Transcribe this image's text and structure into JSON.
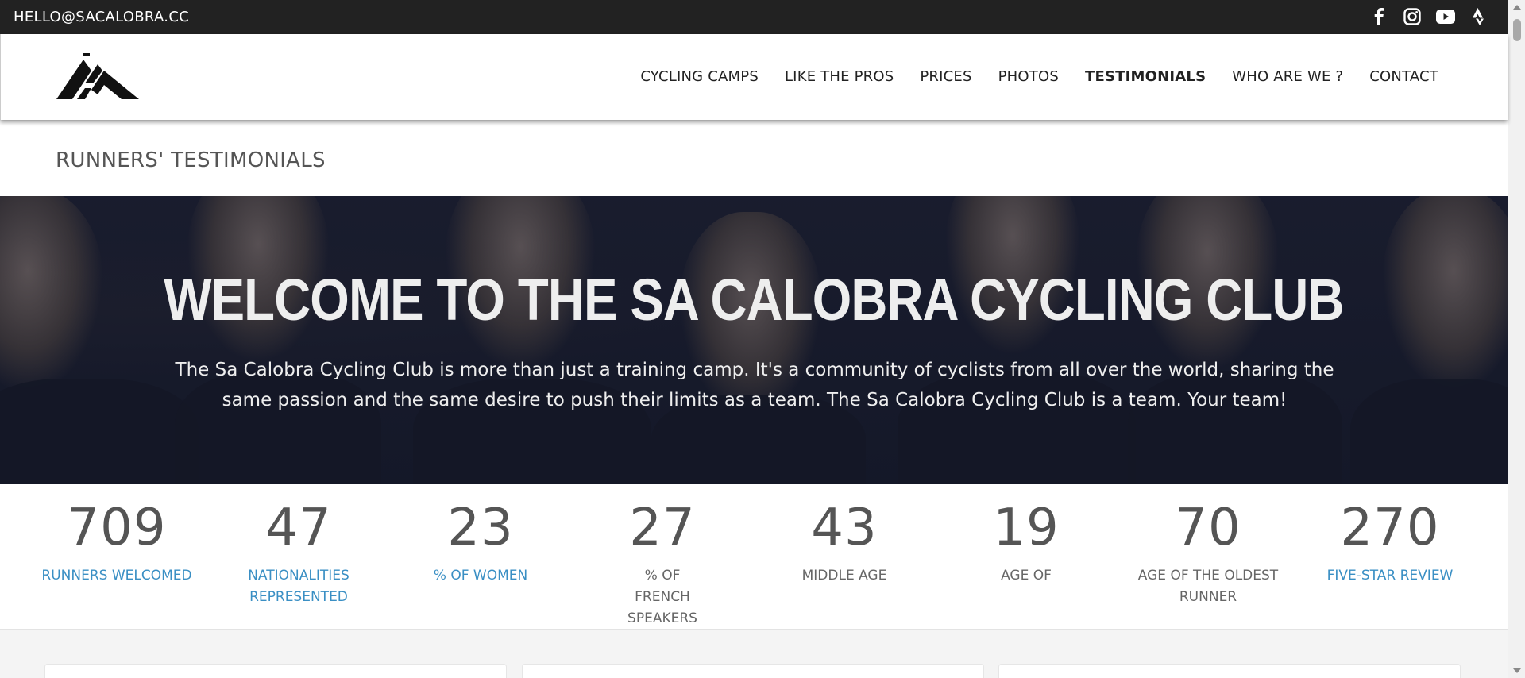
{
  "topbar": {
    "email": "HELLO@SACALOBRA.CC",
    "social": [
      "facebook-icon",
      "instagram-icon",
      "youtube-icon",
      "strava-icon"
    ]
  },
  "nav": {
    "items": [
      {
        "label": "CYCLING CAMPS"
      },
      {
        "label": "LIKE THE PROS"
      },
      {
        "label": "PRICES"
      },
      {
        "label": "PHOTOS"
      },
      {
        "label": "TESTIMONIALS",
        "active": true
      },
      {
        "label": "WHO ARE WE ?"
      },
      {
        "label": "CONTACT"
      }
    ]
  },
  "page": {
    "title": "RUNNERS' TESTIMONIALS"
  },
  "hero": {
    "heading": "WELCOME TO THE SA CALOBRA CYCLING CLUB",
    "text": "The Sa Calobra Cycling Club is more than just a training camp. It's a community of cyclists from all over the world, sharing the same passion and the same desire to push their limits as a team. The Sa Calobra Cycling Club is a team. Your team!"
  },
  "stats": [
    {
      "value": "709",
      "label": "RUNNERS WELCOMED",
      "link": true
    },
    {
      "value": "47",
      "label": "NATIONALITIES REPRESENTED",
      "link": true
    },
    {
      "value": "23",
      "label": "% OF WOMEN",
      "link": true
    },
    {
      "value": "27",
      "label": "% OF FRENCH SPEAKERS",
      "link": false
    },
    {
      "value": "43",
      "label": "MIDDLE AGE",
      "link": false
    },
    {
      "value": "19",
      "label": "AGE OF",
      "link": false
    },
    {
      "value": "70",
      "label": "AGE OF THE OLDEST RUNNER",
      "link": false
    },
    {
      "value": "270",
      "label": "FIVE-STAR REVIEW",
      "link": true
    }
  ],
  "colors": {
    "topbar": "#222222",
    "link": "#3a8fc4",
    "hero_overlay": "#1b1f33"
  }
}
